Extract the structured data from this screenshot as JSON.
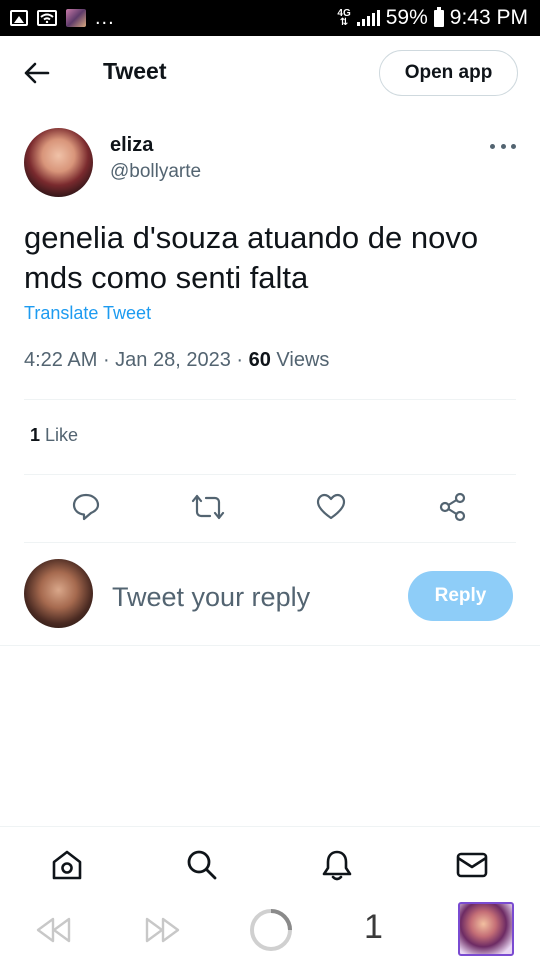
{
  "status_bar": {
    "network": "4G",
    "battery": "59%",
    "time": "9:43 PM",
    "overflow": "..."
  },
  "header": {
    "title": "Tweet",
    "open_app_label": "Open app"
  },
  "tweet": {
    "author_name": "eliza",
    "author_handle": "@bollyarte",
    "text": "genelia d'souza atuando de novo mds como senti falta",
    "translate_label": "Translate Tweet",
    "time": "4:22 AM",
    "date": "Jan 28, 2023",
    "views_count": "60",
    "views_label": "Views",
    "likes_count": "1",
    "likes_label": "Like"
  },
  "actions": {
    "icons": [
      "reply-icon",
      "retweet-icon",
      "like-icon",
      "share-icon"
    ]
  },
  "reply": {
    "placeholder": "Tweet your reply",
    "button_label": "Reply"
  },
  "bottom_nav": {
    "icons": [
      "home-icon",
      "search-icon",
      "notifications-icon",
      "messages-icon"
    ]
  },
  "browser_bar": {
    "tab_count": "1"
  },
  "colors": {
    "accent": "#1d9bf0",
    "reply_button": "#8ecdf8",
    "text_primary": "#0f1419",
    "text_secondary": "#536471",
    "divider": "#eff3f4"
  }
}
